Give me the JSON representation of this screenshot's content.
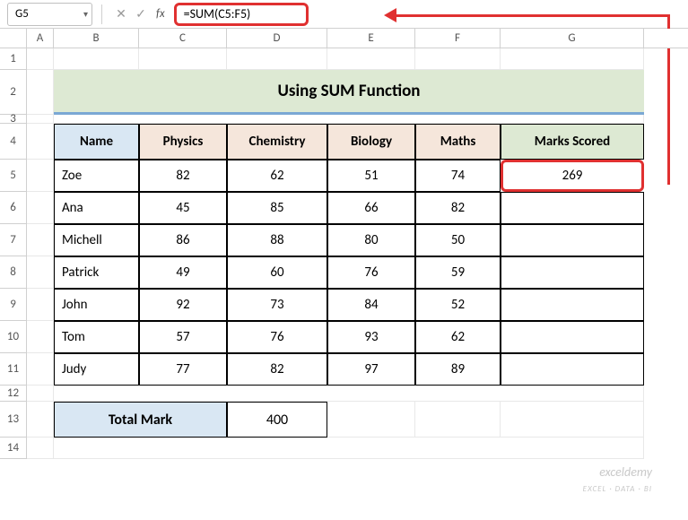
{
  "nameBox": "G5",
  "formula": "=SUM(C5:F5)",
  "fxLabel": "fx",
  "columns": [
    "A",
    "B",
    "C",
    "D",
    "E",
    "F",
    "G"
  ],
  "rows": [
    "1",
    "2",
    "3",
    "4",
    "5",
    "6",
    "7",
    "8",
    "9",
    "10",
    "11",
    "12",
    "13",
    "14"
  ],
  "title": "Using SUM Function",
  "headers": {
    "name": "Name",
    "physics": "Physics",
    "chemistry": "Chemistry",
    "biology": "Biology",
    "maths": "Maths",
    "scored": "Marks Scored"
  },
  "data": [
    {
      "name": "Zoe",
      "p": "82",
      "c": "62",
      "b": "51",
      "m": "74",
      "s": "269"
    },
    {
      "name": "Ana",
      "p": "45",
      "c": "85",
      "b": "66",
      "m": "82",
      "s": ""
    },
    {
      "name": "Michell",
      "p": "86",
      "c": "88",
      "b": "80",
      "m": "50",
      "s": ""
    },
    {
      "name": "Patrick",
      "p": "49",
      "c": "60",
      "b": "76",
      "m": "59",
      "s": ""
    },
    {
      "name": "John",
      "p": "92",
      "c": "73",
      "b": "84",
      "m": "52",
      "s": ""
    },
    {
      "name": "Tom",
      "p": "57",
      "c": "76",
      "b": "93",
      "m": "62",
      "s": ""
    },
    {
      "name": "Judy",
      "p": "77",
      "c": "82",
      "b": "97",
      "m": "89",
      "s": ""
    }
  ],
  "totalMark": {
    "label": "Total Mark",
    "value": "400"
  },
  "watermark": {
    "brand": "exceldemy",
    "tag": "EXCEL · DATA · BI"
  }
}
